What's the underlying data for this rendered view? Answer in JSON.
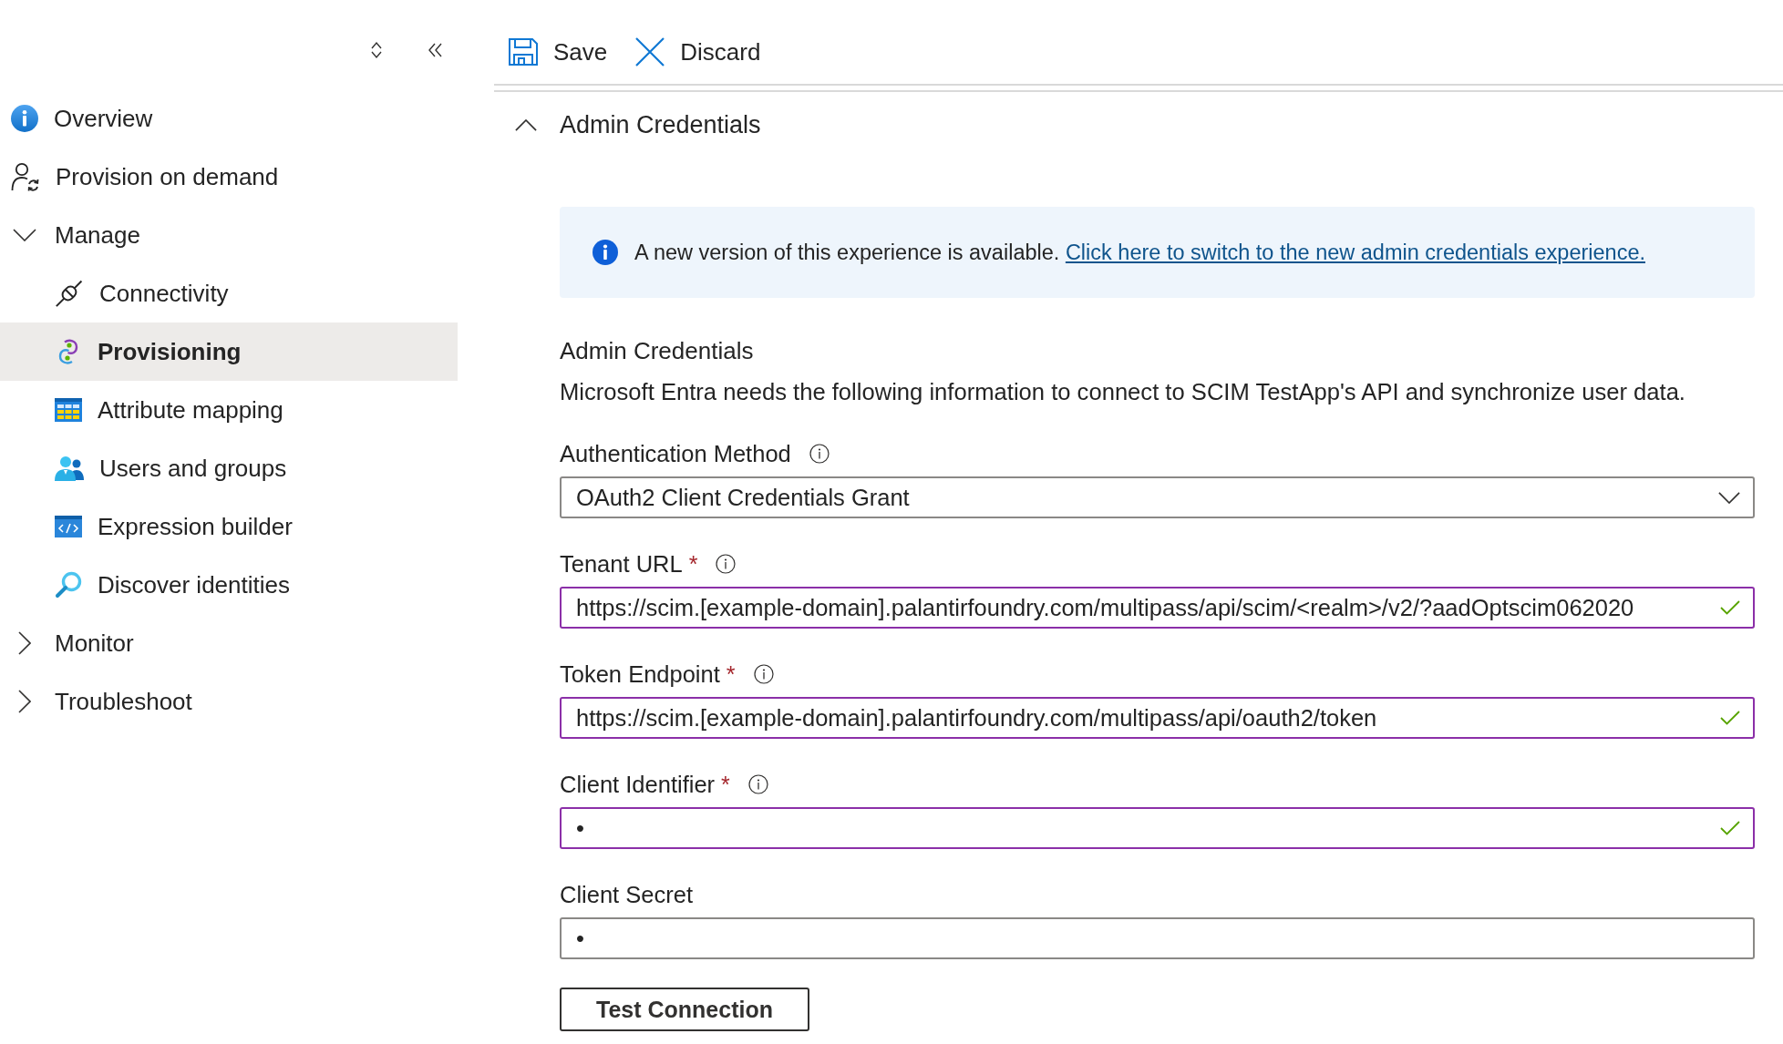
{
  "sidebar": {
    "items": [
      {
        "kind": "link",
        "label": "Overview",
        "selected": false
      },
      {
        "kind": "link",
        "label": "Provision on demand",
        "selected": false
      },
      {
        "kind": "group",
        "label": "Manage",
        "expanded": true,
        "children": [
          {
            "label": "Connectivity",
            "selected": false
          },
          {
            "label": "Provisioning",
            "selected": true
          },
          {
            "label": "Attribute mapping",
            "selected": false
          },
          {
            "label": "Users and groups",
            "selected": false
          },
          {
            "label": "Expression builder",
            "selected": false
          },
          {
            "label": "Discover identities",
            "selected": false
          }
        ]
      },
      {
        "kind": "group",
        "label": "Monitor",
        "expanded": false
      },
      {
        "kind": "group",
        "label": "Troubleshoot",
        "expanded": false
      }
    ]
  },
  "toolbar": {
    "buttons": [
      {
        "label": "Save"
      },
      {
        "label": "Discard"
      }
    ]
  },
  "section": {
    "title": "Admin Credentials",
    "expanded": true
  },
  "banner": {
    "text": "A new version of this experience is available.",
    "link": "Click here to switch to the new admin credentials experience."
  },
  "form": {
    "title": "Admin Credentials",
    "description": "Microsoft Entra needs the following information to connect to SCIM TestApp's API and synchronize user data.",
    "fields": [
      {
        "kind": "dropdown",
        "label": "Authentication Method",
        "info": true,
        "value": "OAuth2 Client Credentials Grant",
        "valid": false
      },
      {
        "kind": "text",
        "label": "Tenant URL",
        "required_mark": "*",
        "info": true,
        "value": "https://scim.[example-domain].palantirfoundry.com/multipass/api/scim/<realm>/v2/?aadOptscim062020",
        "valid": true
      },
      {
        "kind": "text",
        "label": "Token Endpoint",
        "required_mark": "*",
        "info": true,
        "value": "https://scim.[example-domain].palantirfoundry.com/multipass/api/oauth2/token",
        "valid": true
      },
      {
        "kind": "text",
        "label": "Client Identifier",
        "required_mark": "*",
        "info": true,
        "value": "•",
        "valid": true
      },
      {
        "kind": "text",
        "label": "Client Secret",
        "info": false,
        "value": "•",
        "valid": false
      }
    ]
  },
  "actions": [
    {
      "label": "Test Connection"
    }
  ]
}
